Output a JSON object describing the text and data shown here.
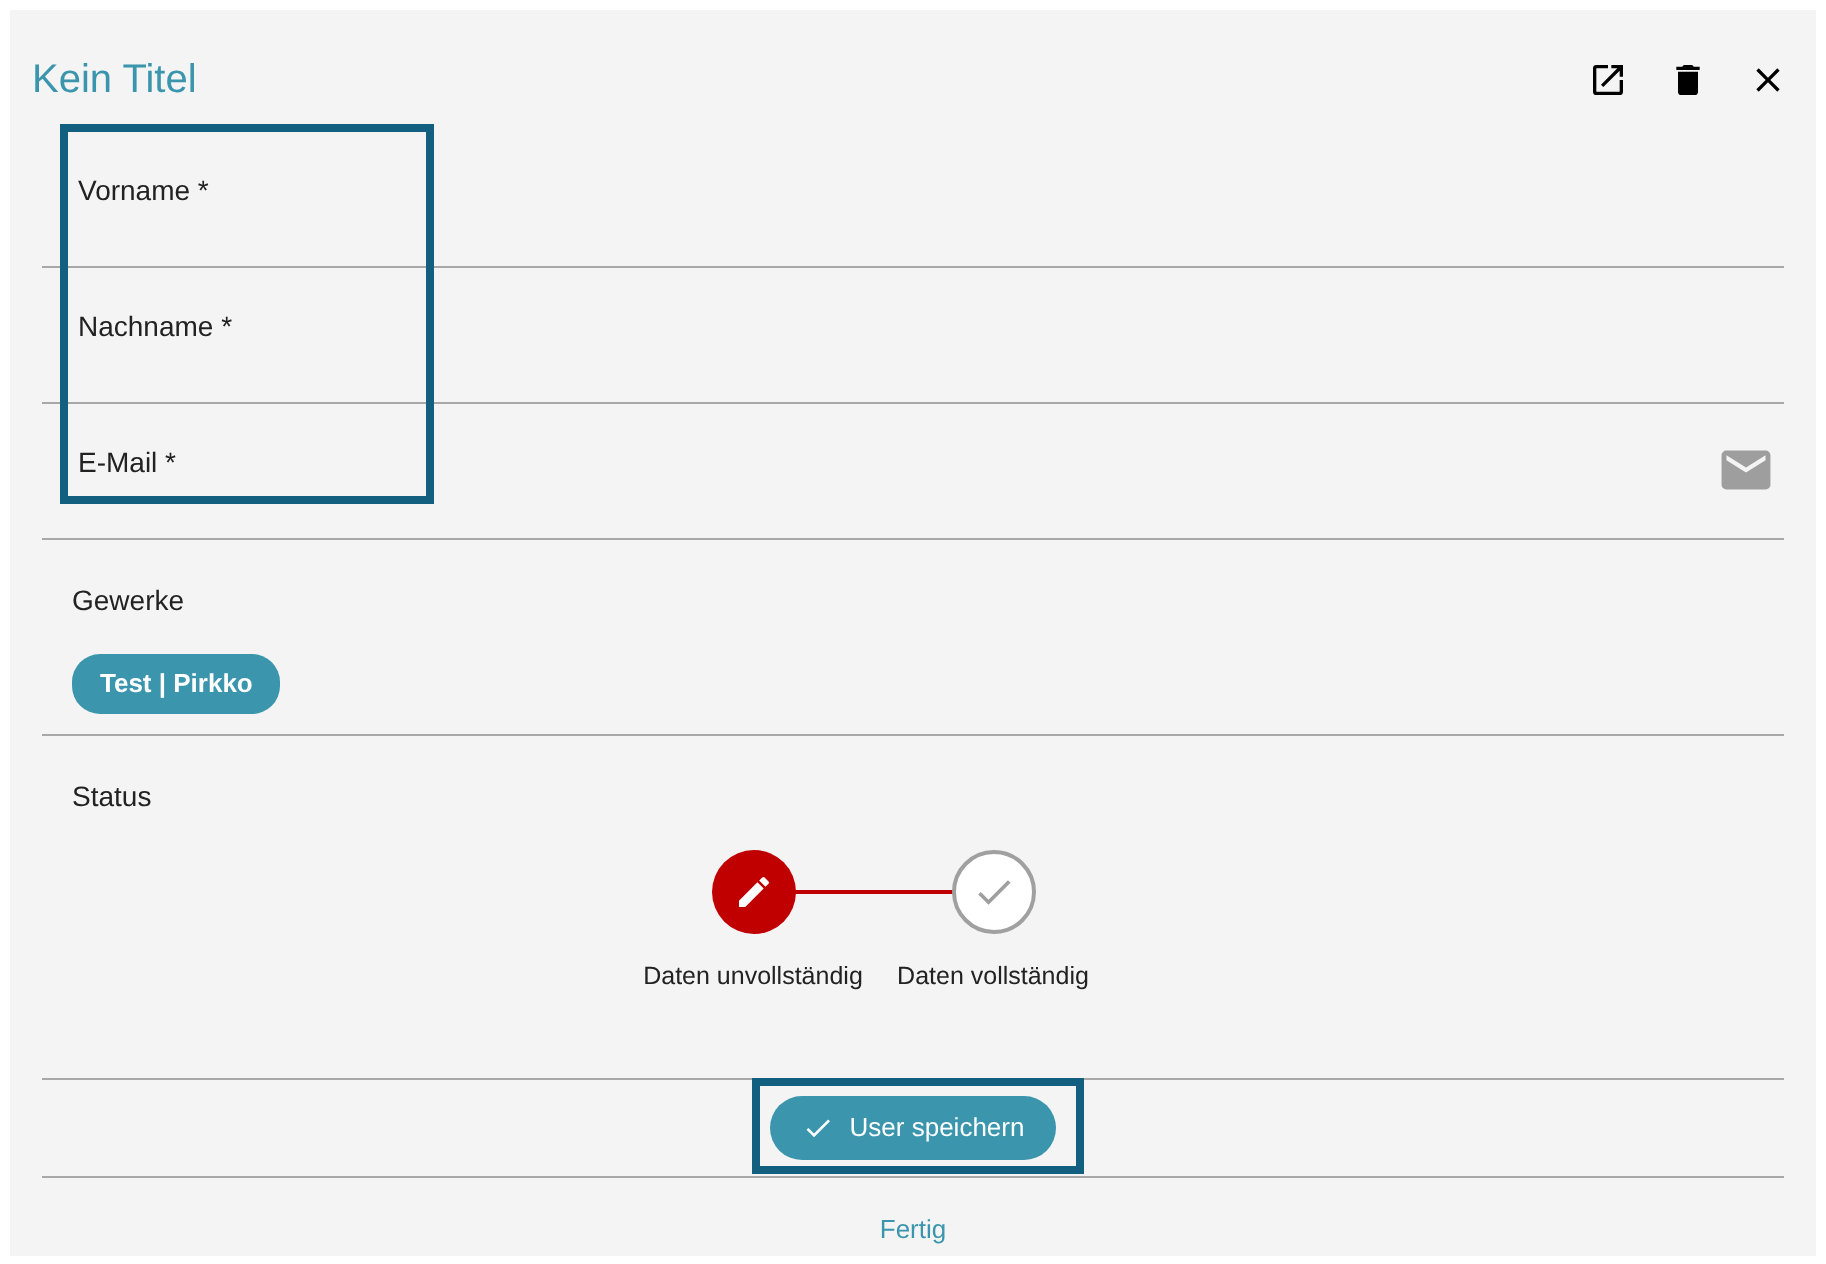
{
  "dialog": {
    "title": "Kein Titel",
    "actions": [
      {
        "kind": "open"
      },
      {
        "kind": "delete"
      },
      {
        "kind": "close"
      }
    ]
  },
  "fields": [
    {
      "placeholder": "Vorname *",
      "kind": "text"
    },
    {
      "placeholder": "Nachname *",
      "kind": "text"
    },
    {
      "placeholder": "E-Mail *",
      "kind": "email"
    }
  ],
  "fields_highlighted": true,
  "gewerke": {
    "label": "Gewerke",
    "chips": [
      "Test | Pirkko"
    ]
  },
  "status": {
    "label": "Status",
    "steps": [
      {
        "label": "Daten unvollständig",
        "active": true
      },
      {
        "label": "Daten vollständig",
        "active": false
      }
    ]
  },
  "save_button": {
    "label": "User speichern",
    "highlighted": true
  },
  "footer": {
    "link": "Fertig"
  }
}
